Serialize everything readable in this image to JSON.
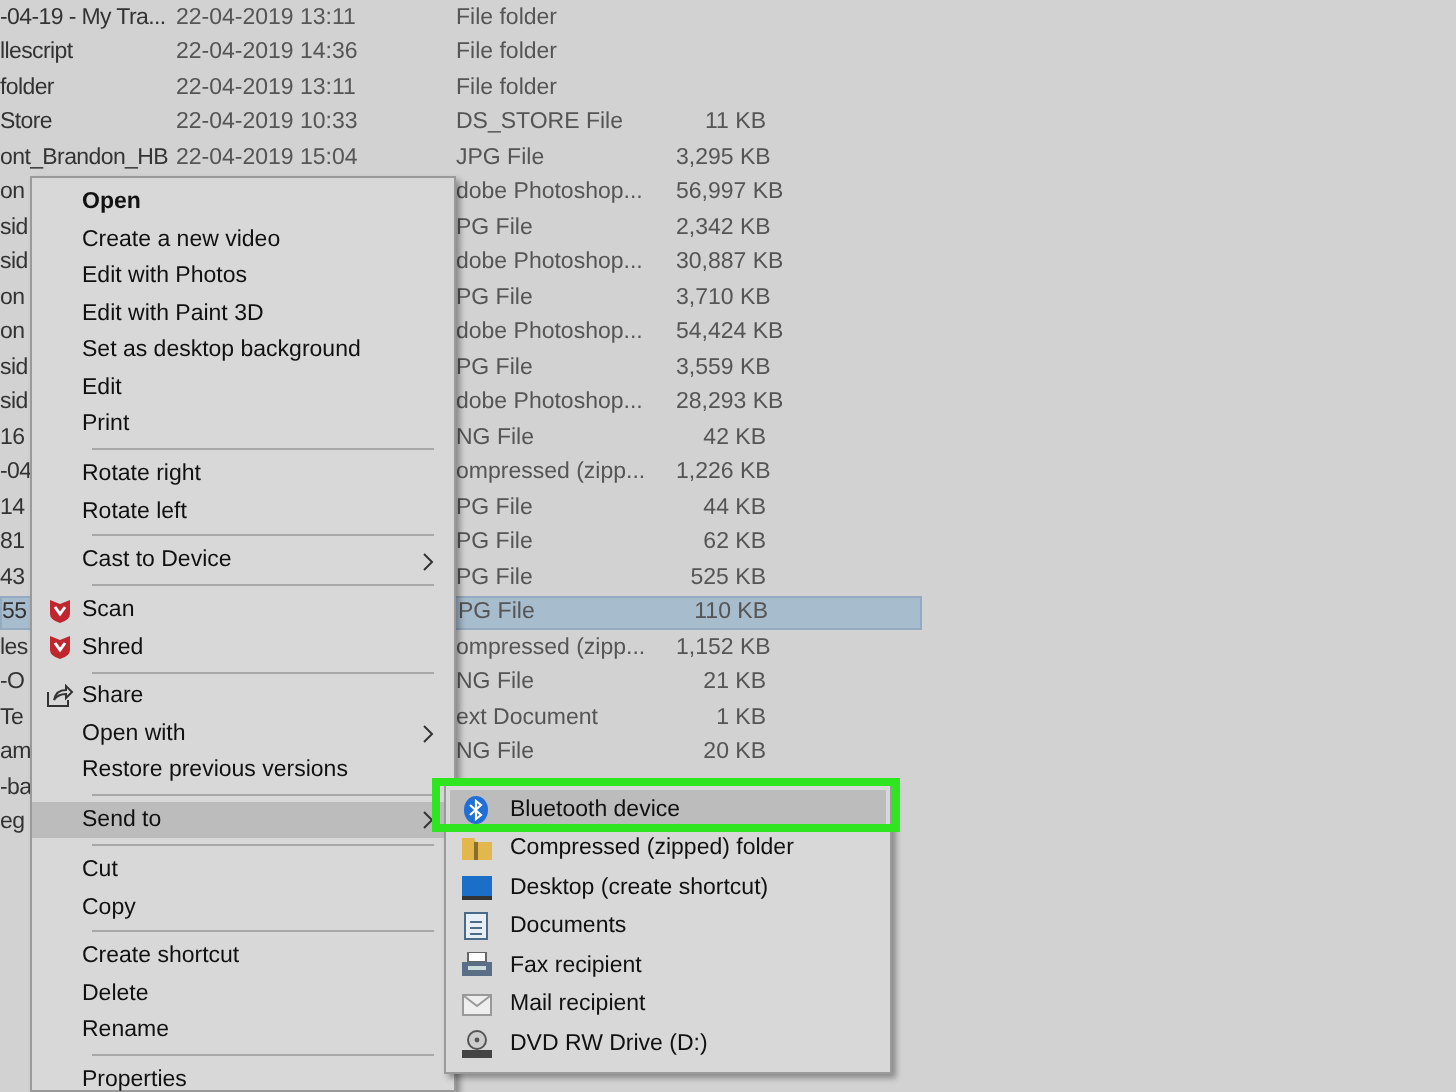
{
  "files": {
    "rows": [
      {
        "name": "-04-19 - My Tra...",
        "date": "22-04-2019 13:11",
        "type": "File folder",
        "size": "",
        "selected": false
      },
      {
        "name": "llescript",
        "date": "22-04-2019 14:36",
        "type": "File folder",
        "size": "",
        "selected": false
      },
      {
        "name": "folder",
        "date": "22-04-2019 13:11",
        "type": "File folder",
        "size": "",
        "selected": false
      },
      {
        "name": "Store",
        "date": "22-04-2019 10:33",
        "type": "DS_STORE File",
        "size": "11 KB",
        "selected": false
      },
      {
        "name": "ont_Brandon_HB",
        "date": "22-04-2019 15:04",
        "type": "JPG File",
        "size": "3,295 KB",
        "selected": false
      },
      {
        "name": "on",
        "date": "",
        "type": "dobe Photoshop...",
        "size": "56,997 KB",
        "selected": false
      },
      {
        "name": "sid",
        "date": "",
        "type": "PG File",
        "size": "2,342 KB",
        "selected": false
      },
      {
        "name": "sid",
        "date": "",
        "type": "dobe Photoshop...",
        "size": "30,887 KB",
        "selected": false
      },
      {
        "name": "on",
        "date": "",
        "type": "PG File",
        "size": "3,710 KB",
        "selected": false
      },
      {
        "name": "on",
        "date": "",
        "type": "dobe Photoshop...",
        "size": "54,424 KB",
        "selected": false
      },
      {
        "name": "sid",
        "date": "",
        "type": "PG File",
        "size": "3,559 KB",
        "selected": false
      },
      {
        "name": "sid",
        "date": "",
        "type": "dobe Photoshop...",
        "size": "28,293 KB",
        "selected": false
      },
      {
        "name": "16",
        "date": "",
        "type": "NG File",
        "size": "42 KB",
        "selected": false
      },
      {
        "name": "-04",
        "date": "",
        "type": "ompressed (zipp...",
        "size": "1,226 KB",
        "selected": false
      },
      {
        "name": "14",
        "date": "",
        "type": "PG File",
        "size": "44 KB",
        "selected": false
      },
      {
        "name": "81",
        "date": "",
        "type": "PG File",
        "size": "62 KB",
        "selected": false
      },
      {
        "name": "43",
        "date": "",
        "type": "PG File",
        "size": "525 KB",
        "selected": false
      },
      {
        "name": "55",
        "date": "",
        "type": "PG File",
        "size": "110 KB",
        "selected": true
      },
      {
        "name": "les",
        "date": "",
        "type": "ompressed (zipp...",
        "size": "1,152 KB",
        "selected": false
      },
      {
        "name": "-O",
        "date": "",
        "type": "NG File",
        "size": "21 KB",
        "selected": false
      },
      {
        "name": "Te",
        "date": "",
        "type": "ext Document",
        "size": "1 KB",
        "selected": false
      },
      {
        "name": "am",
        "date": "",
        "type": "NG File",
        "size": "20 KB",
        "selected": false
      },
      {
        "name": "-ba",
        "date": "",
        "type": "",
        "size": "",
        "selected": false
      },
      {
        "name": "eg",
        "date": "",
        "type": "",
        "size": "",
        "selected": false
      }
    ]
  },
  "context_menu": {
    "items": [
      {
        "kind": "plain",
        "label": "Open",
        "bold": true,
        "submenu": false,
        "selected": false
      },
      {
        "kind": "plain",
        "label": "Create a new video",
        "bold": false,
        "submenu": false,
        "selected": false
      },
      {
        "kind": "plain",
        "label": "Edit with Photos",
        "bold": false,
        "submenu": false,
        "selected": false
      },
      {
        "kind": "plain",
        "label": "Edit with Paint 3D",
        "bold": false,
        "submenu": false,
        "selected": false
      },
      {
        "kind": "plain",
        "label": "Set as desktop background",
        "bold": false,
        "submenu": false,
        "selected": false
      },
      {
        "kind": "plain",
        "label": "Edit",
        "bold": false,
        "submenu": false,
        "selected": false
      },
      {
        "kind": "plain",
        "label": "Print",
        "bold": false,
        "submenu": false,
        "selected": false
      },
      {
        "kind": "separator"
      },
      {
        "kind": "plain",
        "label": "Rotate right",
        "bold": false,
        "submenu": false,
        "selected": false
      },
      {
        "kind": "plain",
        "label": "Rotate left",
        "bold": false,
        "submenu": false,
        "selected": false
      },
      {
        "kind": "separator"
      },
      {
        "kind": "plain",
        "label": "Cast to Device",
        "bold": false,
        "submenu": true,
        "selected": false
      },
      {
        "kind": "separator"
      },
      {
        "kind": "shield",
        "label": "Scan",
        "bold": false,
        "submenu": false,
        "selected": false
      },
      {
        "kind": "shield",
        "label": "Shred",
        "bold": false,
        "submenu": false,
        "selected": false
      },
      {
        "kind": "separator"
      },
      {
        "kind": "share",
        "label": "Share",
        "bold": false,
        "submenu": false,
        "selected": false
      },
      {
        "kind": "plain",
        "label": "Open with",
        "bold": false,
        "submenu": true,
        "selected": false
      },
      {
        "kind": "plain",
        "label": "Restore previous versions",
        "bold": false,
        "submenu": false,
        "selected": false
      },
      {
        "kind": "separator"
      },
      {
        "kind": "plain",
        "label": "Send to",
        "bold": false,
        "submenu": true,
        "selected": true
      },
      {
        "kind": "separator"
      },
      {
        "kind": "plain",
        "label": "Cut",
        "bold": false,
        "submenu": false,
        "selected": false
      },
      {
        "kind": "plain",
        "label": "Copy",
        "bold": false,
        "submenu": false,
        "selected": false
      },
      {
        "kind": "separator"
      },
      {
        "kind": "plain",
        "label": "Create shortcut",
        "bold": false,
        "submenu": false,
        "selected": false
      },
      {
        "kind": "plain",
        "label": "Delete",
        "bold": false,
        "submenu": false,
        "selected": false
      },
      {
        "kind": "plain",
        "label": "Rename",
        "bold": false,
        "submenu": false,
        "selected": false
      },
      {
        "kind": "separator"
      },
      {
        "kind": "plain",
        "label": "Properties",
        "bold": false,
        "submenu": false,
        "selected": false
      }
    ]
  },
  "send_to_menu": {
    "items": [
      {
        "kind": "bluetooth",
        "label": "Bluetooth device",
        "selected": true
      },
      {
        "kind": "zip",
        "label": "Compressed (zipped) folder",
        "selected": false
      },
      {
        "kind": "desktop",
        "label": "Desktop (create shortcut)",
        "selected": false
      },
      {
        "kind": "documents",
        "label": "Documents",
        "selected": false
      },
      {
        "kind": "fax",
        "label": "Fax recipient",
        "selected": false
      },
      {
        "kind": "mail",
        "label": "Mail recipient",
        "selected": false
      },
      {
        "kind": "drive",
        "label": "DVD RW Drive (D:)",
        "selected": false
      }
    ]
  }
}
